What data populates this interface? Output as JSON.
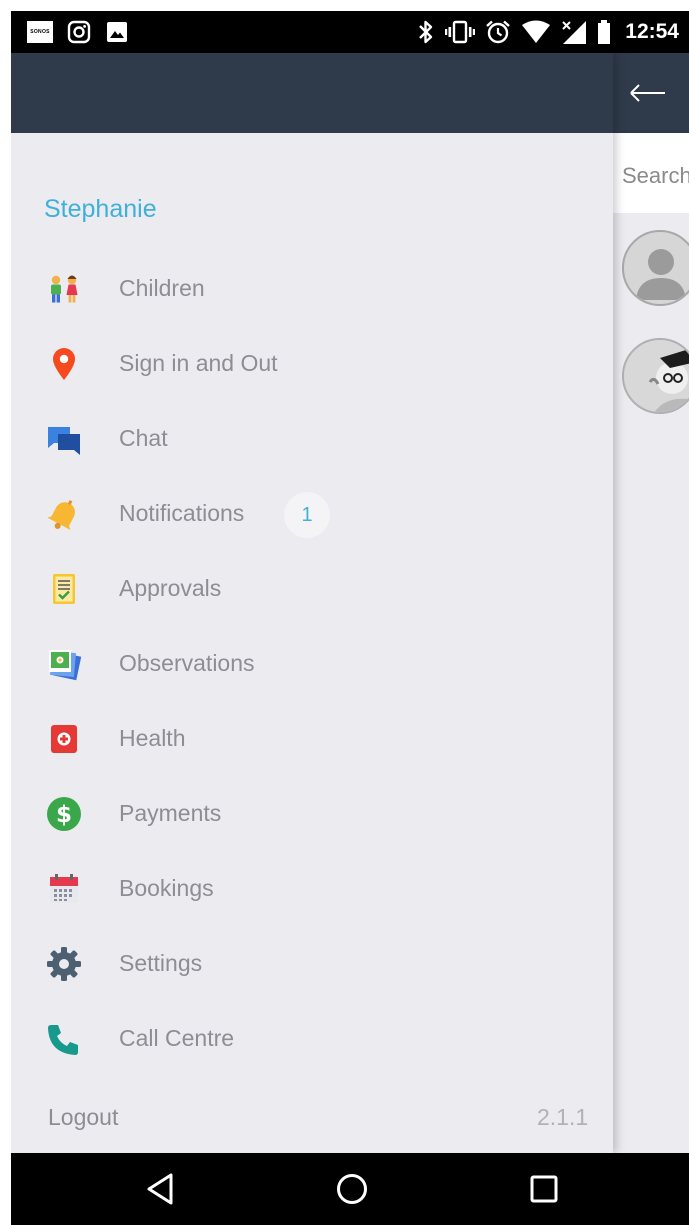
{
  "status_bar": {
    "time": "12:54",
    "left_icons": [
      "sonos-icon",
      "instagram-icon",
      "gallery-icon"
    ],
    "sonos_text": "SONOS",
    "right_icons": [
      "bluetooth-icon",
      "vibrate-icon",
      "alarm-icon",
      "wifi-icon",
      "signal-icon",
      "battery-icon"
    ]
  },
  "drawer": {
    "user_name": "Stephanie",
    "items": [
      {
        "label": "Children",
        "icon": "children-icon"
      },
      {
        "label": "Sign in and Out",
        "icon": "location-pin-icon"
      },
      {
        "label": "Chat",
        "icon": "chat-icon"
      },
      {
        "label": "Notifications",
        "icon": "bell-icon",
        "badge": "1"
      },
      {
        "label": "Approvals",
        "icon": "approvals-icon"
      },
      {
        "label": "Observations",
        "icon": "observations-icon"
      },
      {
        "label": "Health",
        "icon": "health-icon"
      },
      {
        "label": "Payments",
        "icon": "dollar-icon"
      },
      {
        "label": "Bookings",
        "icon": "calendar-icon"
      },
      {
        "label": "Settings",
        "icon": "gear-icon"
      },
      {
        "label": "Call Centre",
        "icon": "phone-icon"
      }
    ],
    "logout_label": "Logout",
    "version": "2.1.1"
  },
  "behind_panel": {
    "search_placeholder": "Search"
  },
  "colors": {
    "app_bar": "#2f3a4b",
    "accent": "#3fb1d9",
    "drawer_bg": "#ebebf0",
    "label_text": "#8d8d94"
  }
}
